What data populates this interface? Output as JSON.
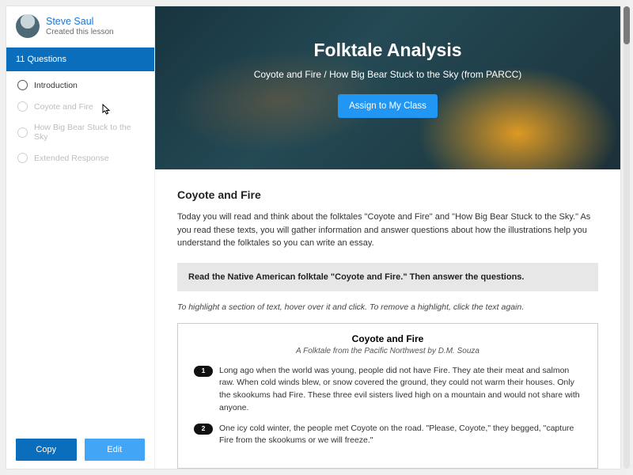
{
  "author": {
    "name": "Steve Saul",
    "sub": "Created this lesson"
  },
  "sidebar": {
    "header": "11 Questions",
    "items": [
      {
        "label": "Introduction",
        "muted": false
      },
      {
        "label": "Coyote and Fire",
        "muted": true
      },
      {
        "label": "How Big Bear Stuck to the Sky",
        "muted": true
      },
      {
        "label": "Extended Response",
        "muted": true
      }
    ],
    "copy": "Copy",
    "edit": "Edit"
  },
  "hero": {
    "title": "Folktale Analysis",
    "subtitle": "Coyote and Fire / How Big Bear Stuck to the Sky (from PARCC)",
    "assign": "Assign to My Class"
  },
  "content": {
    "heading": "Coyote and Fire",
    "intro": "Today you will read and think about the folktales \"Coyote and Fire\" and \"How Big Bear Stuck to the Sky.\" As you read these texts, you will gather information and answer questions about how the illustrations help you understand the folktales so you can write an essay.",
    "instruction": "Read the Native American folktale \"Coyote and Fire.\" Then answer the questions.",
    "tip": "To highlight a section of text, hover over it and click. To remove a highlight, click the text again.",
    "passage": {
      "title": "Coyote and Fire",
      "subtitle": "A Folktale from the Pacific Northwest by D.M. Souza",
      "paragraphs": [
        {
          "n": "1",
          "t": "Long ago when the world was young, people did not have Fire. They ate their meat and salmon raw. When cold winds blew, or snow covered the ground, they could not warm their houses. Only the skookums had Fire. These three evil sisters lived high on a mountain and would not share with anyone."
        },
        {
          "n": "2",
          "t": "One icy cold winter, the people met Coyote on the road. \"Please, Coyote,\" they begged, \"capture Fire from the skookums or we will freeze.\""
        }
      ]
    }
  }
}
